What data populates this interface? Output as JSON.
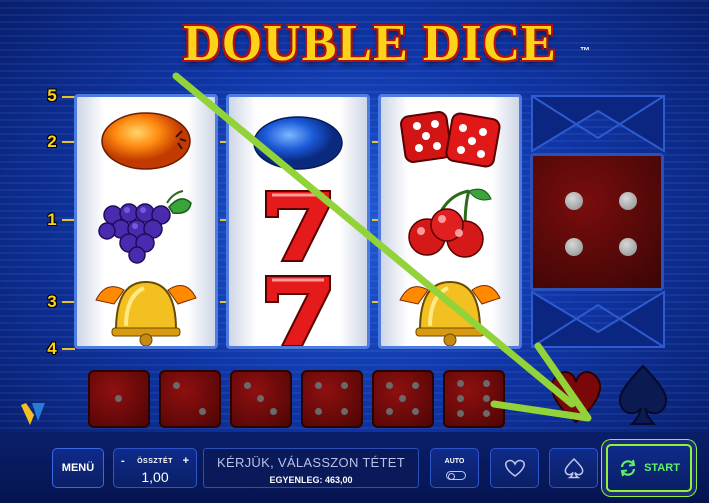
{
  "game": {
    "title": "DOUBLE DICE",
    "trademark": "™"
  },
  "paylines": [
    "5",
    "2",
    "1",
    "3",
    "4"
  ],
  "reels": [
    {
      "symbols": [
        "orange-icon",
        "grapes-icon",
        "bell-icon"
      ]
    },
    {
      "symbols": [
        "plum-icon",
        "seven-icon",
        "seven-icon"
      ]
    },
    {
      "symbols": [
        "dice-icon",
        "cherries-icon",
        "bell-icon"
      ]
    }
  ],
  "bonus_die": {
    "value": 4
  },
  "mini_dice": [
    1,
    2,
    3,
    4,
    5,
    6
  ],
  "controls": {
    "menu_label": "MENÜ",
    "bet_label": "ÖSSZTÉT",
    "bet_minus": "-",
    "bet_plus": "+",
    "bet_value": "1,00",
    "message": "KÉRJÜK, VÁLASSZON TÉTET",
    "balance": "EGYENLEG: 463,00",
    "auto_label": "AUTO",
    "start_label": "START"
  },
  "colors": {
    "accent_green": "#8ef23a",
    "title_gold": "#ffd21a",
    "reel_border": "#4d7be0"
  }
}
